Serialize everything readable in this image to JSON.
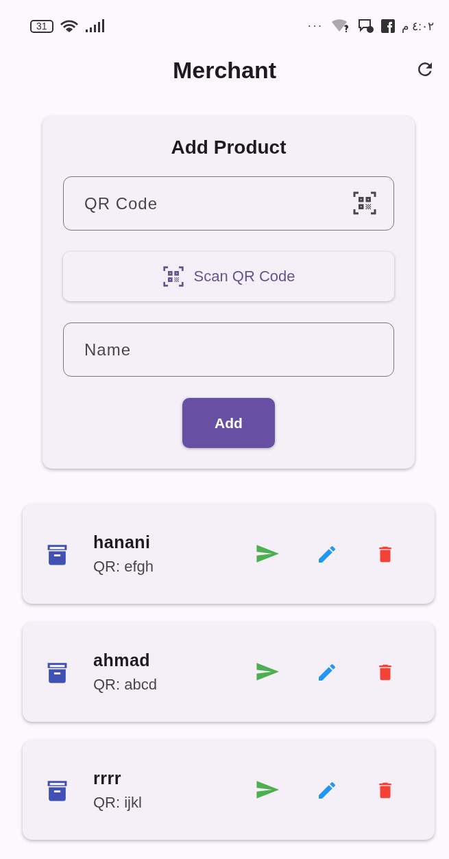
{
  "status_bar": {
    "battery": "31",
    "more": "···",
    "time": "٤:٠٢ م"
  },
  "app_bar": {
    "title": "Merchant"
  },
  "add_product": {
    "title": "Add Product",
    "qr_field": {
      "placeholder": "QR Code"
    },
    "scan_button": "Scan QR Code",
    "name_field": {
      "placeholder": "Name"
    },
    "add_button": "Add"
  },
  "products": [
    {
      "name": "hanani",
      "qr": "QR: efgh"
    },
    {
      "name": "ahmad",
      "qr": "QR: abcd"
    },
    {
      "name": "rrrr",
      "qr": "QR: ijkl"
    }
  ]
}
